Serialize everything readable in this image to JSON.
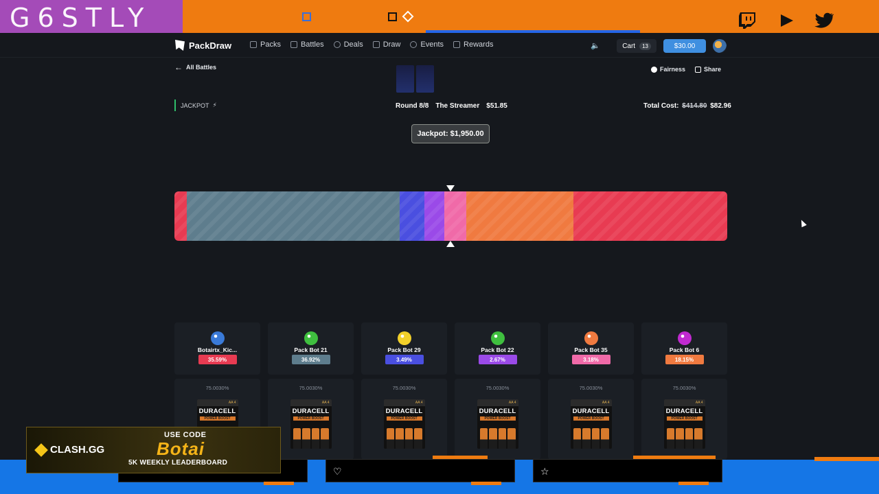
{
  "overlay": {
    "logo_text": "G6STLY",
    "social": [
      "twitch-icon",
      "youtube-icon",
      "twitter-icon"
    ]
  },
  "nav": {
    "brand": "PackDraw",
    "links": [
      {
        "label": "Packs",
        "icon": "packs-icon"
      },
      {
        "label": "Battles",
        "icon": "battles-icon"
      },
      {
        "label": "Deals",
        "icon": "deals-icon"
      },
      {
        "label": "Draw",
        "icon": "draw-icon"
      },
      {
        "label": "Events",
        "icon": "events-icon"
      },
      {
        "label": "Rewards",
        "icon": "rewards-icon"
      }
    ],
    "cart_label": "Cart",
    "cart_count": "13",
    "balance": "$30.00"
  },
  "battle": {
    "back_label": "All Battles",
    "fairness_label": "Fairness",
    "share_label": "Share",
    "mode_label": "JACKPOT",
    "round": "Round 8/8",
    "pack_name": "The Streamer",
    "pack_price": "$51.85",
    "total_label": "Total Cost:",
    "total_original": "$414.80",
    "total_discounted": "$82.96",
    "jackpot": "Jackpot: $1,950.00"
  },
  "jackpot_bar": {
    "segments": [
      {
        "color": "#e83b52",
        "share": 2.2
      },
      {
        "color": "#5e7d8d",
        "share": 38.6
      },
      {
        "color": "#4a4fe0",
        "share": 4.4
      },
      {
        "color": "#9a4ae8",
        "share": 3.6
      },
      {
        "color": "#f06aa8",
        "share": 4.0
      },
      {
        "color": "#f07a40",
        "share": 19.4
      },
      {
        "color": "#e83b52",
        "share": 27.8
      }
    ]
  },
  "players": [
    {
      "name": "Botairtx_Kic...",
      "chance": "35.59%",
      "chance_color": "#e83b52",
      "avatar_color": "#3a7ad8"
    },
    {
      "name": "Pack Bot 21",
      "chance": "36.92%",
      "chance_color": "#5e7d8d",
      "avatar_color": "#3fbf3f"
    },
    {
      "name": "Pack Bot 29",
      "chance": "3.49%",
      "chance_color": "#4a4fe0",
      "avatar_color": "#f2d02a"
    },
    {
      "name": "Pack Bot 22",
      "chance": "2.67%",
      "chance_color": "#9a4ae8",
      "avatar_color": "#3fbf3f"
    },
    {
      "name": "Pack Bot 35",
      "chance": "3.18%",
      "chance_color": "#f06aa8",
      "avatar_color": "#f07a40"
    },
    {
      "name": "Pack Bot 6",
      "chance": "18.15%",
      "chance_color": "#f07a40",
      "avatar_color": "#c02ad0"
    }
  ],
  "items": [
    {
      "odds": "75.0030%",
      "brand": "DURACELL",
      "sub": "POWER BOOST",
      "tag": "AA 4"
    },
    {
      "odds": "75.0030%",
      "brand": "DURACELL",
      "sub": "POWER BOOST",
      "tag": "AA 4"
    },
    {
      "odds": "75.0030%",
      "brand": "DURACELL",
      "sub": "POWER BOOST",
      "tag": "AA 4"
    },
    {
      "odds": "75.0030%",
      "brand": "DURACELL",
      "sub": "POWER BOOST",
      "tag": "AA 4"
    },
    {
      "odds": "75.0030%",
      "brand": "DURACELL",
      "sub": "POWER BOOST",
      "tag": "AA 4"
    },
    {
      "odds": "75.0030%",
      "brand": "DURACELL",
      "sub": "POWER BOOST",
      "tag": "AA 4"
    }
  ],
  "promo": {
    "brand": "CLASH.GG",
    "use_code": "USE CODE",
    "code": "Botai",
    "tagline": "5K WEEKLY LEADERBOARD"
  }
}
